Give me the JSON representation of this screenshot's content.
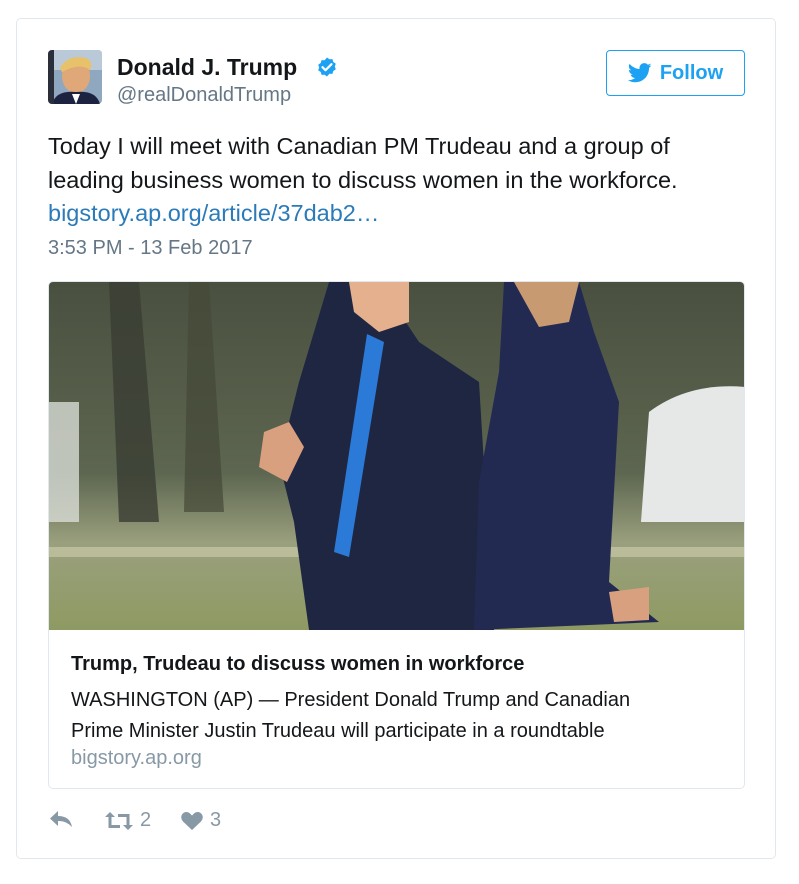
{
  "tweet": {
    "author": {
      "name": "Donald J. Trump",
      "handle": "@realDonaldTrump",
      "verified": true
    },
    "follow_label": "Follow",
    "text_lines": [
      "Today I will meet with Canadian PM Trudeau and a group of",
      "leading business women to discuss women in the workforce."
    ],
    "link": "bigstory.ap.org/article/37dab2…",
    "timestamp": "3:53 PM - 13 Feb 2017",
    "card": {
      "title": "Trump, Trudeau to discuss women in workforce",
      "description_lines": [
        "WASHINGTON (AP) — President Donald Trump and Canadian",
        "Prime Minister Justin Trudeau will participate in a roundtable"
      ],
      "domain": "bigstory.ap.org"
    },
    "actions": {
      "reply_icon": "reply-icon",
      "retweet_icon": "retweet-icon",
      "retweet_count": "2",
      "like_icon": "heart-icon",
      "like_count": "3"
    }
  },
  "colors": {
    "accent": "#1da1f2",
    "link": "#2b7bb9",
    "muted": "#657786",
    "border": "#e1e8ed"
  }
}
